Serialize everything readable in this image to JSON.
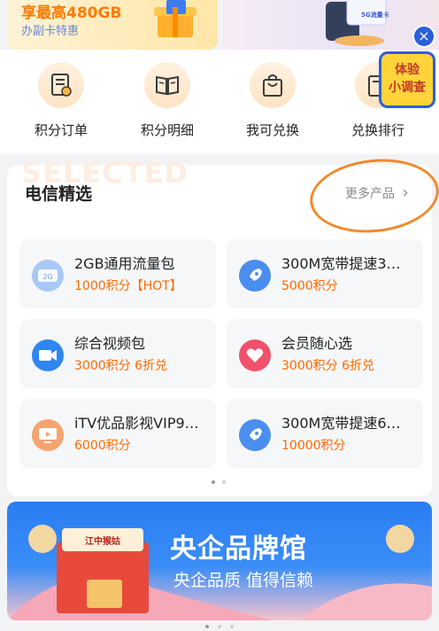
{
  "promo_left": {
    "title": "享最高480GB",
    "subtitle": "办副卡特惠"
  },
  "promo_right": {
    "sim_text": "5G流量卡"
  },
  "shortcuts": [
    {
      "label": "积分订单",
      "icon": "order-list-icon"
    },
    {
      "label": "积分明细",
      "icon": "open-book-icon"
    },
    {
      "label": "我可兑换",
      "icon": "shopping-bag-icon"
    },
    {
      "label": "兑换排行",
      "icon": "ranking-icon"
    }
  ],
  "survey": {
    "line1": "体验",
    "line2": "小调查",
    "close": "×"
  },
  "selection": {
    "watermark": "SELECTED",
    "title": "电信精选",
    "more": "更多产品",
    "more_chevron": "›",
    "products": [
      {
        "name": "2GB通用流量包",
        "price": "1000积分【HOT】",
        "icon": "data-package-icon",
        "color": "#8fb6f5"
      },
      {
        "name": "300M宽带提速3…",
        "price": "5000积分",
        "icon": "rocket-icon",
        "color": "#4a8ef0"
      },
      {
        "name": "综合视频包",
        "price": "3000积分 6折兑",
        "icon": "video-camera-icon",
        "color": "#2f86f0"
      },
      {
        "name": "会员随心选",
        "price": "3000积分 6折兑",
        "icon": "heart-badge-icon",
        "color": "#f0506a"
      },
      {
        "name": "iTV优品影视VIP9…",
        "price": "6000积分",
        "icon": "tv-icon",
        "color": "#f5a470"
      },
      {
        "name": "300M宽带提速6…",
        "price": "10000积分",
        "icon": "rocket-icon",
        "color": "#4a8ef0"
      }
    ]
  },
  "bottom_banner": {
    "title": "央企品牌馆",
    "subtitle": "央企品质 值得信赖",
    "box_label": "江中猴姑"
  },
  "colors": {
    "accent_orange": "#ff6a00",
    "brand_blue": "#2b5fd9"
  }
}
